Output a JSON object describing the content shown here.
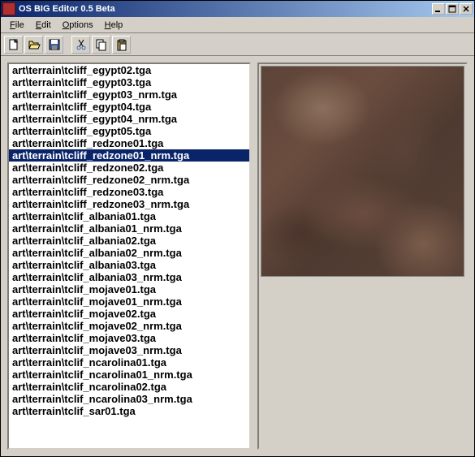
{
  "window": {
    "title": "OS BIG Editor 0.5 Beta"
  },
  "menu": {
    "file": "File",
    "edit": "Edit",
    "options": "Options",
    "help": "Help"
  },
  "toolbar": {
    "new": "new",
    "open": "open",
    "save": "save",
    "cut": "cut",
    "copy": "copy",
    "paste": "paste"
  },
  "files": {
    "selected_index": 7,
    "items": [
      "art\\terrain\\tcliff_egypt02.tga",
      "art\\terrain\\tcliff_egypt03.tga",
      "art\\terrain\\tcliff_egypt03_nrm.tga",
      "art\\terrain\\tcliff_egypt04.tga",
      "art\\terrain\\tcliff_egypt04_nrm.tga",
      "art\\terrain\\tcliff_egypt05.tga",
      "art\\terrain\\tcliff_redzone01.tga",
      "art\\terrain\\tcliff_redzone01_nrm.tga",
      "art\\terrain\\tcliff_redzone02.tga",
      "art\\terrain\\tcliff_redzone02_nrm.tga",
      "art\\terrain\\tcliff_redzone03.tga",
      "art\\terrain\\tcliff_redzone03_nrm.tga",
      "art\\terrain\\tclif_albania01.tga",
      "art\\terrain\\tclif_albania01_nrm.tga",
      "art\\terrain\\tclif_albania02.tga",
      "art\\terrain\\tclif_albania02_nrm.tga",
      "art\\terrain\\tclif_albania03.tga",
      "art\\terrain\\tclif_albania03_nrm.tga",
      "art\\terrain\\tclif_mojave01.tga",
      "art\\terrain\\tclif_mojave01_nrm.tga",
      "art\\terrain\\tclif_mojave02.tga",
      "art\\terrain\\tclif_mojave02_nrm.tga",
      "art\\terrain\\tclif_mojave03.tga",
      "art\\terrain\\tclif_mojave03_nrm.tga",
      "art\\terrain\\tclif_ncarolina01.tga",
      "art\\terrain\\tclif_ncarolina01_nrm.tga",
      "art\\terrain\\tclif_ncarolina02.tga",
      "art\\terrain\\tclif_ncarolina03_nrm.tga",
      "art\\terrain\\tclif_sar01.tga"
    ]
  }
}
